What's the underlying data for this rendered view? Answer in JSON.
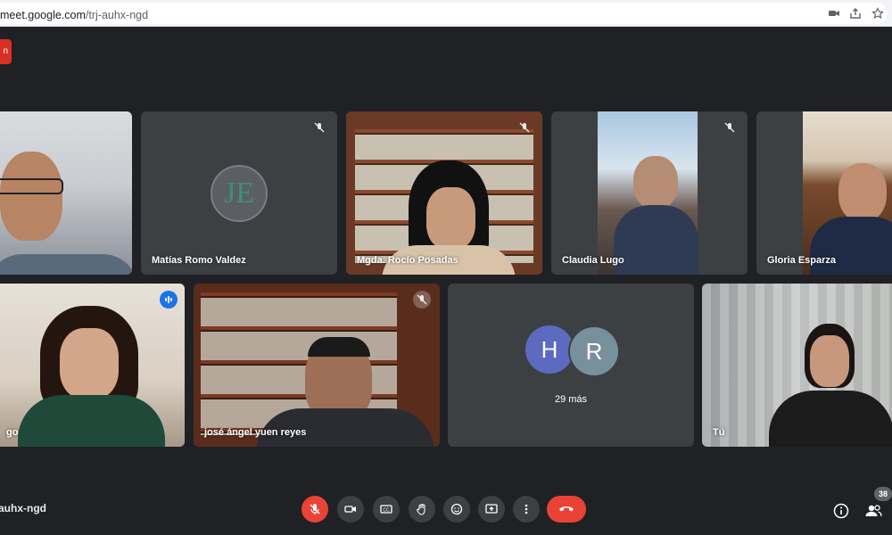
{
  "browser": {
    "url_host": "meet.google.com",
    "url_path": "/trj-auhx-ngd"
  },
  "meeting": {
    "code_partial": "auhx-ngd",
    "participants_count": "38",
    "rec_label": "n"
  },
  "tiles": [
    {
      "name": ""
    },
    {
      "name": "Matías Romo Valdez"
    },
    {
      "name": "Mgda. Rocío Posadas"
    },
    {
      "name": "Claudia Lugo"
    },
    {
      "name": "Gloria Esparza"
    },
    {
      "name": "go"
    },
    {
      "name": "josé ángel yuen reyes"
    },
    {
      "name": "",
      "avatars": [
        "H",
        "R"
      ],
      "more": "29 más"
    },
    {
      "name": "Tú"
    }
  ],
  "colors": {
    "avatar_h": "#5c6bc0",
    "avatar_r": "#78909c",
    "accent": "#8ab4f8",
    "danger": "#ea4335"
  },
  "icons": [
    "lock-icon",
    "camera-icon",
    "share-icon",
    "star-icon",
    "mic-off-icon",
    "video-icon",
    "captions-icon",
    "hand-icon",
    "emoji-icon",
    "present-icon",
    "more-icon",
    "end-call-icon",
    "info-icon",
    "people-icon"
  ]
}
